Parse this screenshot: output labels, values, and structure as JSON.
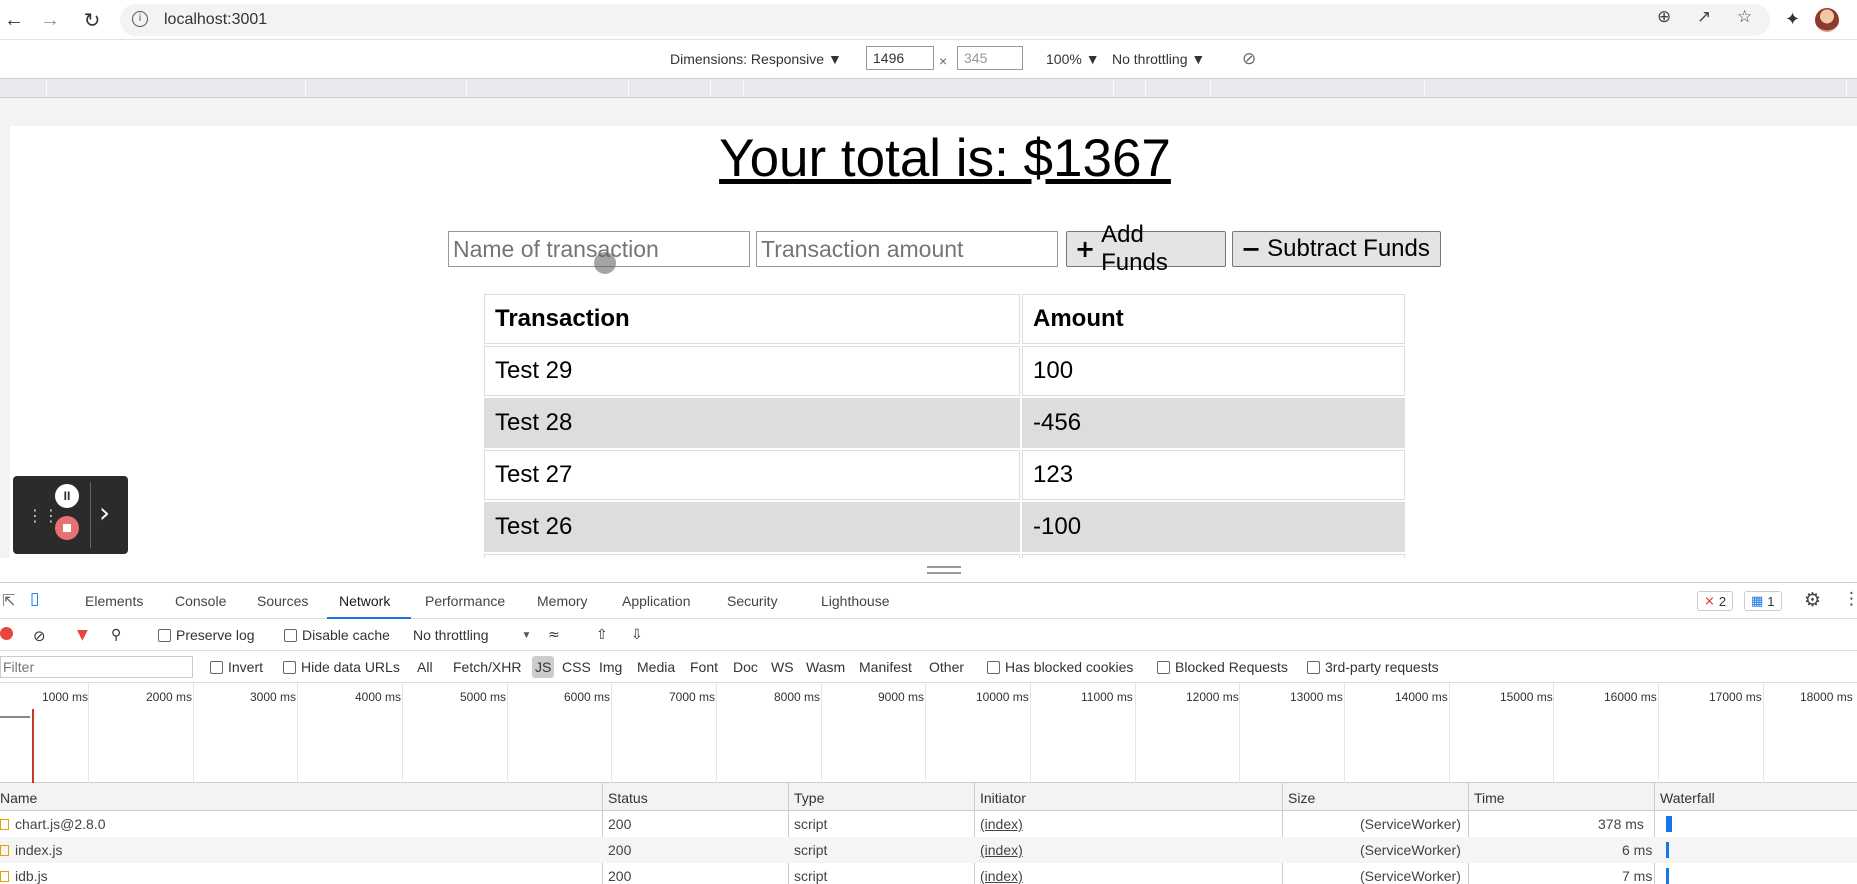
{
  "browser": {
    "url": "localhost:3001",
    "accent": "#1a73e8"
  },
  "device_toolbar": {
    "dimensions_label": "Dimensions: Responsive ▼",
    "width": "1496",
    "times": "×",
    "height": "345",
    "zoom": "100% ▼",
    "throttling": "No throttling ▼"
  },
  "app": {
    "total_title": "Your total is: $1367",
    "name_placeholder": "Name of transaction",
    "amount_placeholder": "Transaction amount",
    "add_label": "Add Funds",
    "subtract_label": "Subtract Funds",
    "table_headers": [
      "Transaction",
      "Amount"
    ],
    "transactions": [
      {
        "name": "Test 29",
        "amount": "100"
      },
      {
        "name": "Test 28",
        "amount": "-456"
      },
      {
        "name": "Test 27",
        "amount": "123"
      },
      {
        "name": "Test 26",
        "amount": "-100"
      }
    ]
  },
  "devtools": {
    "tabs": [
      "Elements",
      "Console",
      "Sources",
      "Network",
      "Performance",
      "Memory",
      "Application",
      "Security",
      "Lighthouse"
    ],
    "active_tab": "Network",
    "error_count": "2",
    "message_count": "1",
    "toolbar": {
      "preserve_log": "Preserve log",
      "disable_cache": "Disable cache",
      "throttling": "No throttling"
    },
    "filter": {
      "placeholder": "Filter",
      "invert": "Invert",
      "hide_data_urls": "Hide data URLs",
      "types": [
        "All",
        "Fetch/XHR",
        "JS",
        "CSS",
        "Img",
        "Media",
        "Font",
        "Doc",
        "WS",
        "Wasm",
        "Manifest",
        "Other"
      ],
      "active_type": "JS",
      "has_blocked_cookies": "Has blocked cookies",
      "blocked_requests": "Blocked Requests",
      "third_party": "3rd-party requests"
    },
    "timeline_ticks": [
      "1000 ms",
      "2000 ms",
      "3000 ms",
      "4000 ms",
      "5000 ms",
      "6000 ms",
      "7000 ms",
      "8000 ms",
      "9000 ms",
      "10000 ms",
      "11000 ms",
      "12000 ms",
      "13000 ms",
      "14000 ms",
      "15000 ms",
      "16000 ms",
      "17000 ms",
      "18000 ms"
    ],
    "columns": [
      "Name",
      "Status",
      "Type",
      "Initiator",
      "Size",
      "Time",
      "Waterfall"
    ],
    "requests": [
      {
        "name": "chart.js@2.8.0",
        "status": "200",
        "type": "script",
        "initiator": "(index)",
        "size": "(ServiceWorker)",
        "time": "378 ms"
      },
      {
        "name": "index.js",
        "status": "200",
        "type": "script",
        "initiator": "(index)",
        "size": "(ServiceWorker)",
        "time": "6 ms"
      },
      {
        "name": "idb.js",
        "status": "200",
        "type": "script",
        "initiator": "(index)",
        "size": "(ServiceWorker)",
        "time": "7 ms"
      }
    ]
  }
}
